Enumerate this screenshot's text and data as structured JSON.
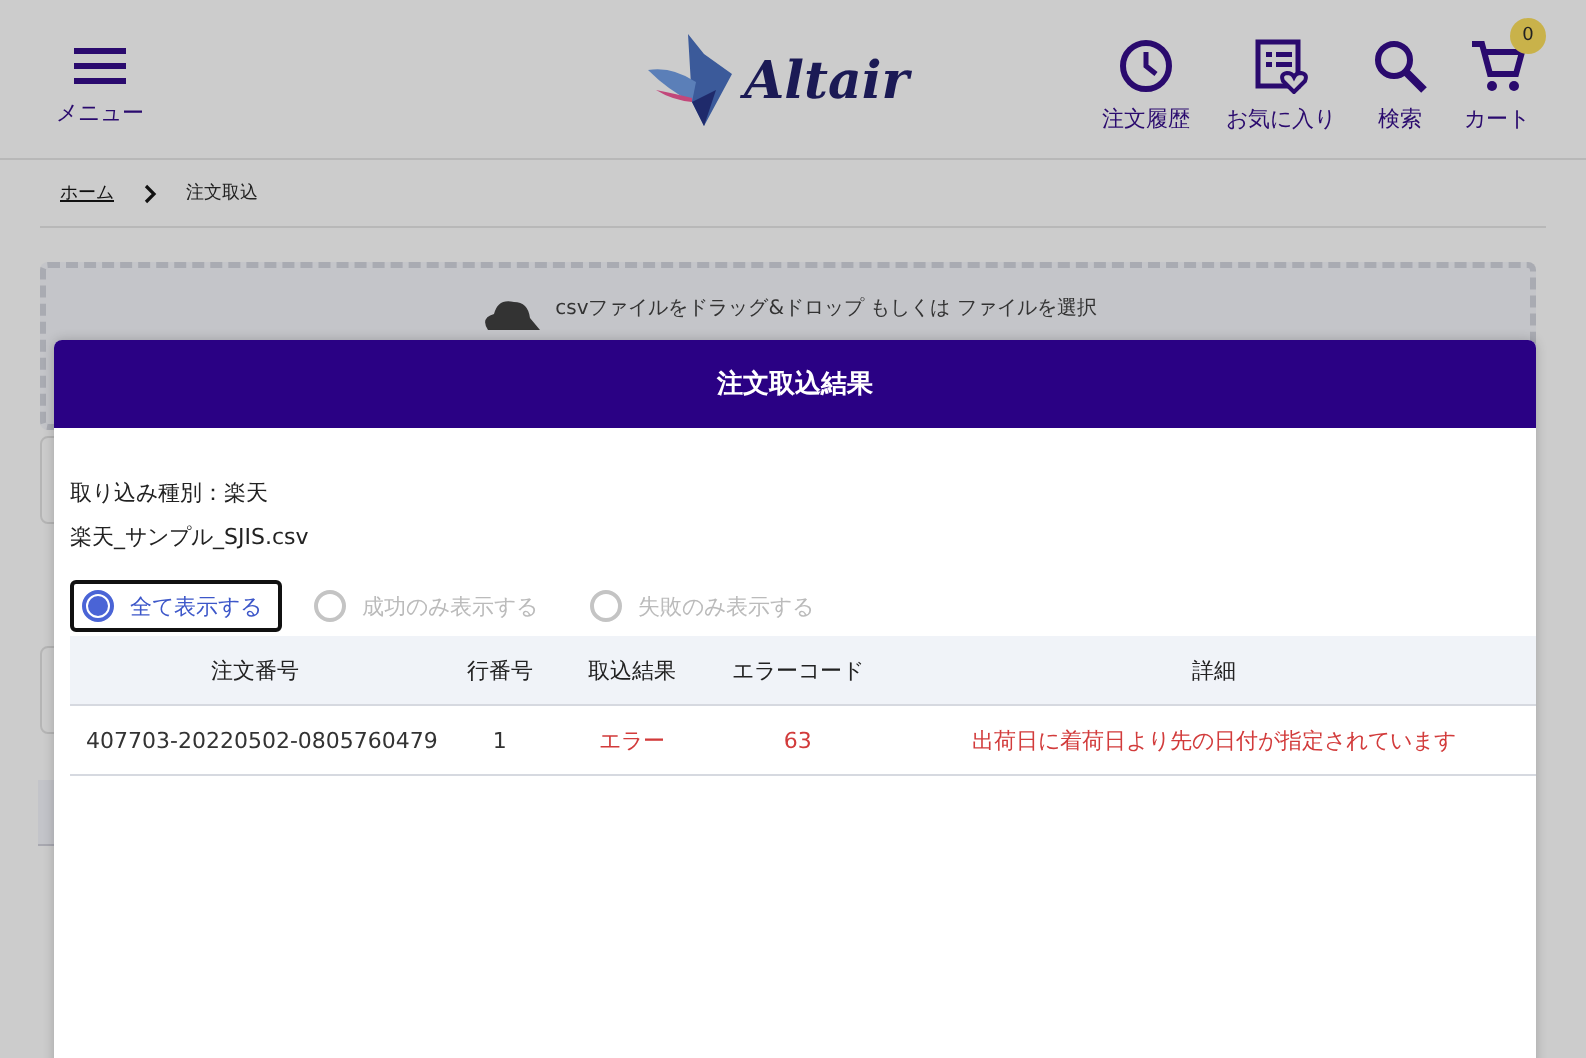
{
  "header": {
    "menu_label": "メニュー",
    "logo": "Altair",
    "nav": [
      {
        "kind": "history",
        "label": "注文履歴"
      },
      {
        "kind": "favorites",
        "label": "お気に入り"
      },
      {
        "kind": "search",
        "label": "検索"
      },
      {
        "kind": "cart",
        "label": "カート",
        "badge": "0"
      }
    ]
  },
  "breadcrumb": [
    {
      "label": "ホーム",
      "link": true
    },
    {
      "label": "注文取込",
      "link": false
    }
  ],
  "dropzone": {
    "text": "csvファイルをドラッグ&ドロップ もしくは ファイルを選択"
  },
  "modal": {
    "title": "注文取込結果",
    "import_type": "取り込み種別：楽天",
    "filename": "楽天_サンプル_SJIS.csv",
    "filters": [
      {
        "label": "全て表示する",
        "selected": true
      },
      {
        "label": "成功のみ表示する",
        "selected": false
      },
      {
        "label": "失敗のみ表示する",
        "selected": false
      }
    ],
    "table": {
      "columns": [
        "注文番号",
        "行番号",
        "取込結果",
        "エラーコード",
        "詳細"
      ],
      "rows": [
        {
          "error": true,
          "cells": [
            "407703-20220502-0805760479",
            "1",
            "エラー",
            "63",
            "出荷日に着荷日より先の日付が指定されています"
          ]
        }
      ]
    }
  }
}
